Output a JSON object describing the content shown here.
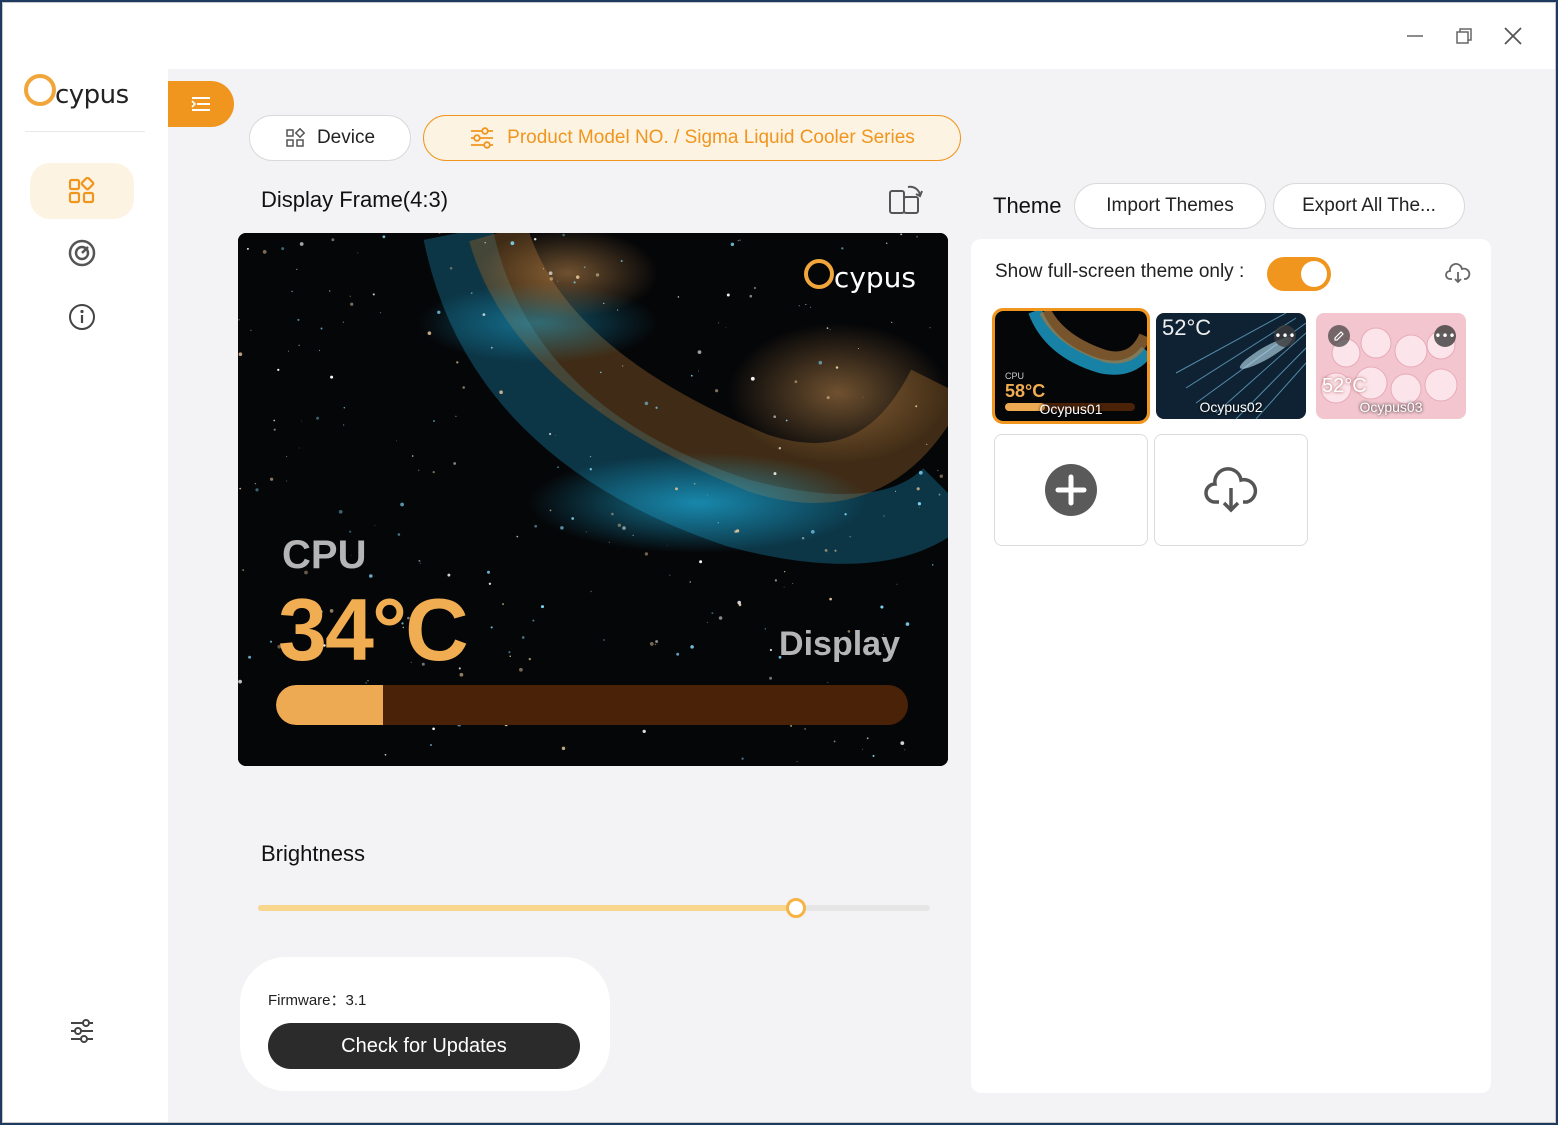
{
  "app": {
    "logo_text": "cypus"
  },
  "window_controls": {
    "minimize": "—",
    "maximize": "❐",
    "close": "✕"
  },
  "tabs": {
    "device_label": "Device",
    "model_label": "Product Model NO. / Sigma Liquid Cooler Series"
  },
  "display": {
    "title": "Display Frame(4:3)",
    "preview": {
      "logo_text": "cypus",
      "cpu_label": "CPU",
      "temp": "34°C",
      "display_label": "Display",
      "bar_fill": 0.17
    }
  },
  "brightness": {
    "label": "Brightness",
    "value": 0.8
  },
  "firmware": {
    "label": "Firmware：3.1",
    "update_button": "Check for Updates"
  },
  "theme": {
    "title": "Theme",
    "import_button": "Import Themes",
    "export_button": "Export All The...",
    "fullscreen_label": "Show full-screen theme only :",
    "fullscreen_on": true,
    "items": [
      {
        "name": "Ocypus01",
        "temp": "58°C",
        "cpu": "CPU",
        "selected": true
      },
      {
        "name": "Ocypus02",
        "temp": "52°C",
        "selected": false
      },
      {
        "name": "Ocypus03",
        "temp": "52°C",
        "selected": false
      }
    ]
  },
  "colors": {
    "accent": "#f0961e",
    "accent_light": "#fdf3e3",
    "dark": "#2b2b2b",
    "panel_bg": "#f3f3f5"
  }
}
